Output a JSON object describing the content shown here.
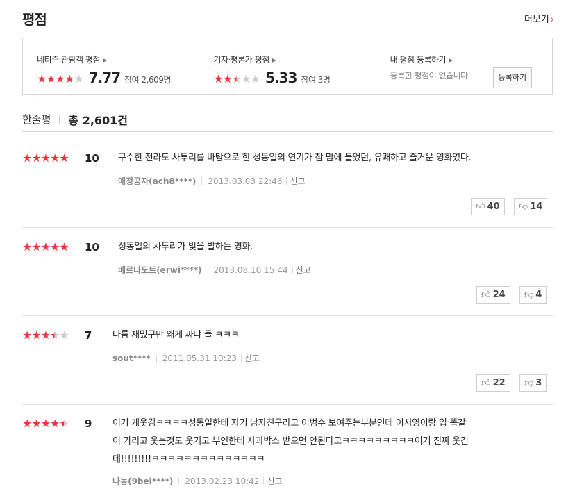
{
  "header": {
    "title": "평점",
    "more_label": "더보기"
  },
  "summary": {
    "netizen": {
      "label": "네티즌·관람객 평점",
      "stars": [
        1,
        1,
        1,
        1,
        0
      ],
      "score": "7.77",
      "participate": "참여 2,609명"
    },
    "critic": {
      "label": "기자·평론가 평점",
      "stars": [
        1,
        1,
        0.5,
        0,
        0
      ],
      "score": "5.33",
      "participate": "참여 3명"
    },
    "mine": {
      "label": "내 평점 등록하기",
      "status": "등록한 평점이 없습니다.",
      "button": "등록하기"
    }
  },
  "count_bar": {
    "label": "한줄평",
    "total": "총 2,601건"
  },
  "reviews": [
    {
      "stars": [
        1,
        1,
        1,
        1,
        1
      ],
      "score": "10",
      "text": "구수한 전라도 사투리를 바탕으로 한 성동일의 연기가 참 맘에 들었던, 유쾌하고 즐거운 영화였다.",
      "user": "애정공자(ach8****)",
      "date": "2013.03.03 22:46",
      "report": "신고",
      "up": "40",
      "down": "14"
    },
    {
      "stars": [
        1,
        1,
        1,
        1,
        1
      ],
      "score": "10",
      "text": "성동일의 사투리가 빛을 발하는 영화.",
      "user": "베르나도트(erwi****)",
      "date": "2013.08.10 15:44",
      "report": "신고",
      "up": "24",
      "down": "4"
    },
    {
      "stars": [
        1,
        1,
        1,
        0.5,
        0
      ],
      "score": "7",
      "text": "나름 재밌구만 왜케 짜냐 들 ㅋㅋㅋ",
      "user": "sout****",
      "date": "2011.05.31 10:23",
      "report": "신고",
      "up": "22",
      "down": "3"
    },
    {
      "stars": [
        1,
        1,
        1,
        1,
        0.5
      ],
      "score": "9",
      "text_lines": [
        "이거 개웃김ㅋㅋㅋㅋ성동일한테 자기 남자친구라고 이범수 보여주는부분인데 이시영이랑 입 똑같",
        "이 가리고 웃는것도 웃기고 부인한테 사과박스 받으면 안된다고ㅋㅋㅋㅋㅋㅋㅋㅋㅋ이거 진짜 웃긴",
        "데!!!!!!!!!ㅋㅋㅋㅋㅋㅋㅋㅋㅋㅋㅋㅋㅋㅋ"
      ],
      "user": "나농(9bel****)",
      "date": "2013.02.23 10:42",
      "report": "신고"
    }
  ],
  "icons": {
    "thumb_up": "thumb-up-icon",
    "thumb_down": "thumb-down-icon",
    "arrow": "chevron-right-icon"
  },
  "colors": {
    "star_on": "#e8383d",
    "star_off": "#cccccc"
  }
}
